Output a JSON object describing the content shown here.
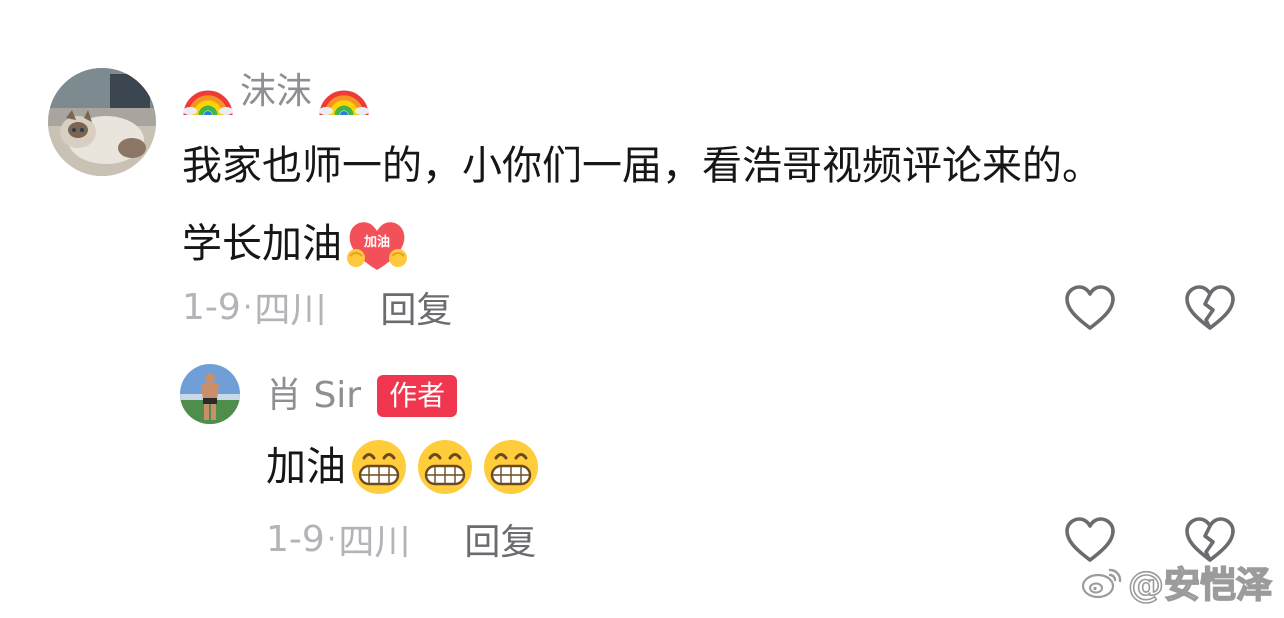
{
  "comment": {
    "username": "沫沫",
    "text_line_1": "我家也师一的，小你们一届，看浩哥视频评论来的。",
    "text_line_2": "学长加油",
    "date": "1-9",
    "location": "四川",
    "reply_label": "回复",
    "icons": {
      "avatar": "cat-avatar",
      "name_decoration": "rainbow-icon",
      "text_emoji": "cheer-heart-emoji",
      "like": "heart-outline-icon",
      "dislike": "broken-heart-icon"
    },
    "emoji_text": "加油",
    "reply": {
      "username": "肖 Sir",
      "badge": "作者",
      "text": "加油",
      "emoji_count": 3,
      "emoji_icon": "grinning-face-emoji",
      "date": "1-9",
      "location": "四川",
      "reply_label": "回复"
    }
  },
  "separator": "·",
  "watermark": {
    "icon": "weibo-logo",
    "text": "@安恺泽"
  },
  "colors": {
    "username": "#8e8e93",
    "text": "#161616",
    "meta": "#b3b3b8",
    "reply_button": "#6b6b70",
    "author_badge_bg": "#f0374f",
    "icon_stroke": "#6b6b70"
  }
}
